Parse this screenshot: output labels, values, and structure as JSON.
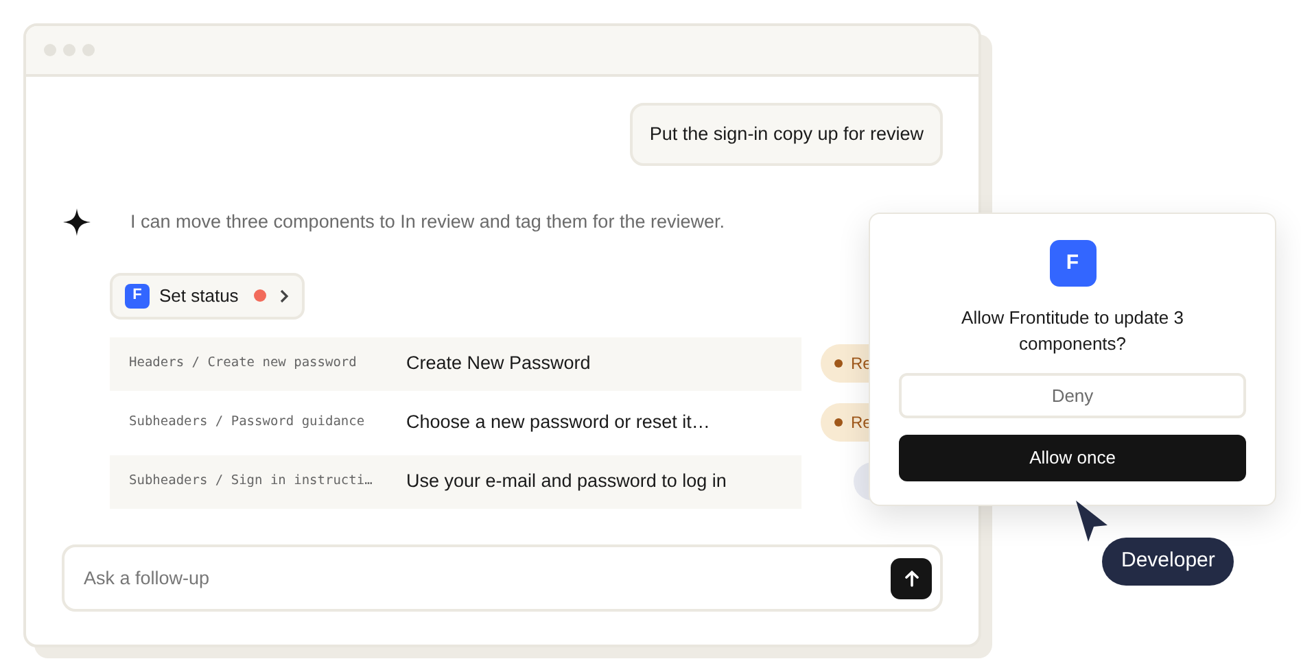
{
  "user_message": "Put the sign-in copy up for review",
  "assistant_message": "I can move three components to In review and tag them for the reviewer.",
  "tool_chip": {
    "badge": "F",
    "label": "Set status",
    "color": "#f26b5b"
  },
  "rows": [
    {
      "path": "Headers / Create new password",
      "text": "Create New Password",
      "status": {
        "label": "Re",
        "color": "#f8ead2"
      }
    },
    {
      "path": "Subheaders / Password guidance",
      "text": "Choose a new password or reset it…",
      "status": {
        "label": "Re",
        "color": "#f8ead2"
      }
    },
    {
      "path": "Subheaders / Sign in instructi…",
      "text": "Use your e-mail and password to log in",
      "status": {
        "color": "#e9ebf3"
      }
    }
  ],
  "input": {
    "placeholder": "Ask a follow-up"
  },
  "dialog": {
    "badge": "F",
    "question": "Allow Frontitude to update 3 components?",
    "buttons": [
      "Deny",
      "Allow once"
    ]
  },
  "cursor_label": "Developer"
}
